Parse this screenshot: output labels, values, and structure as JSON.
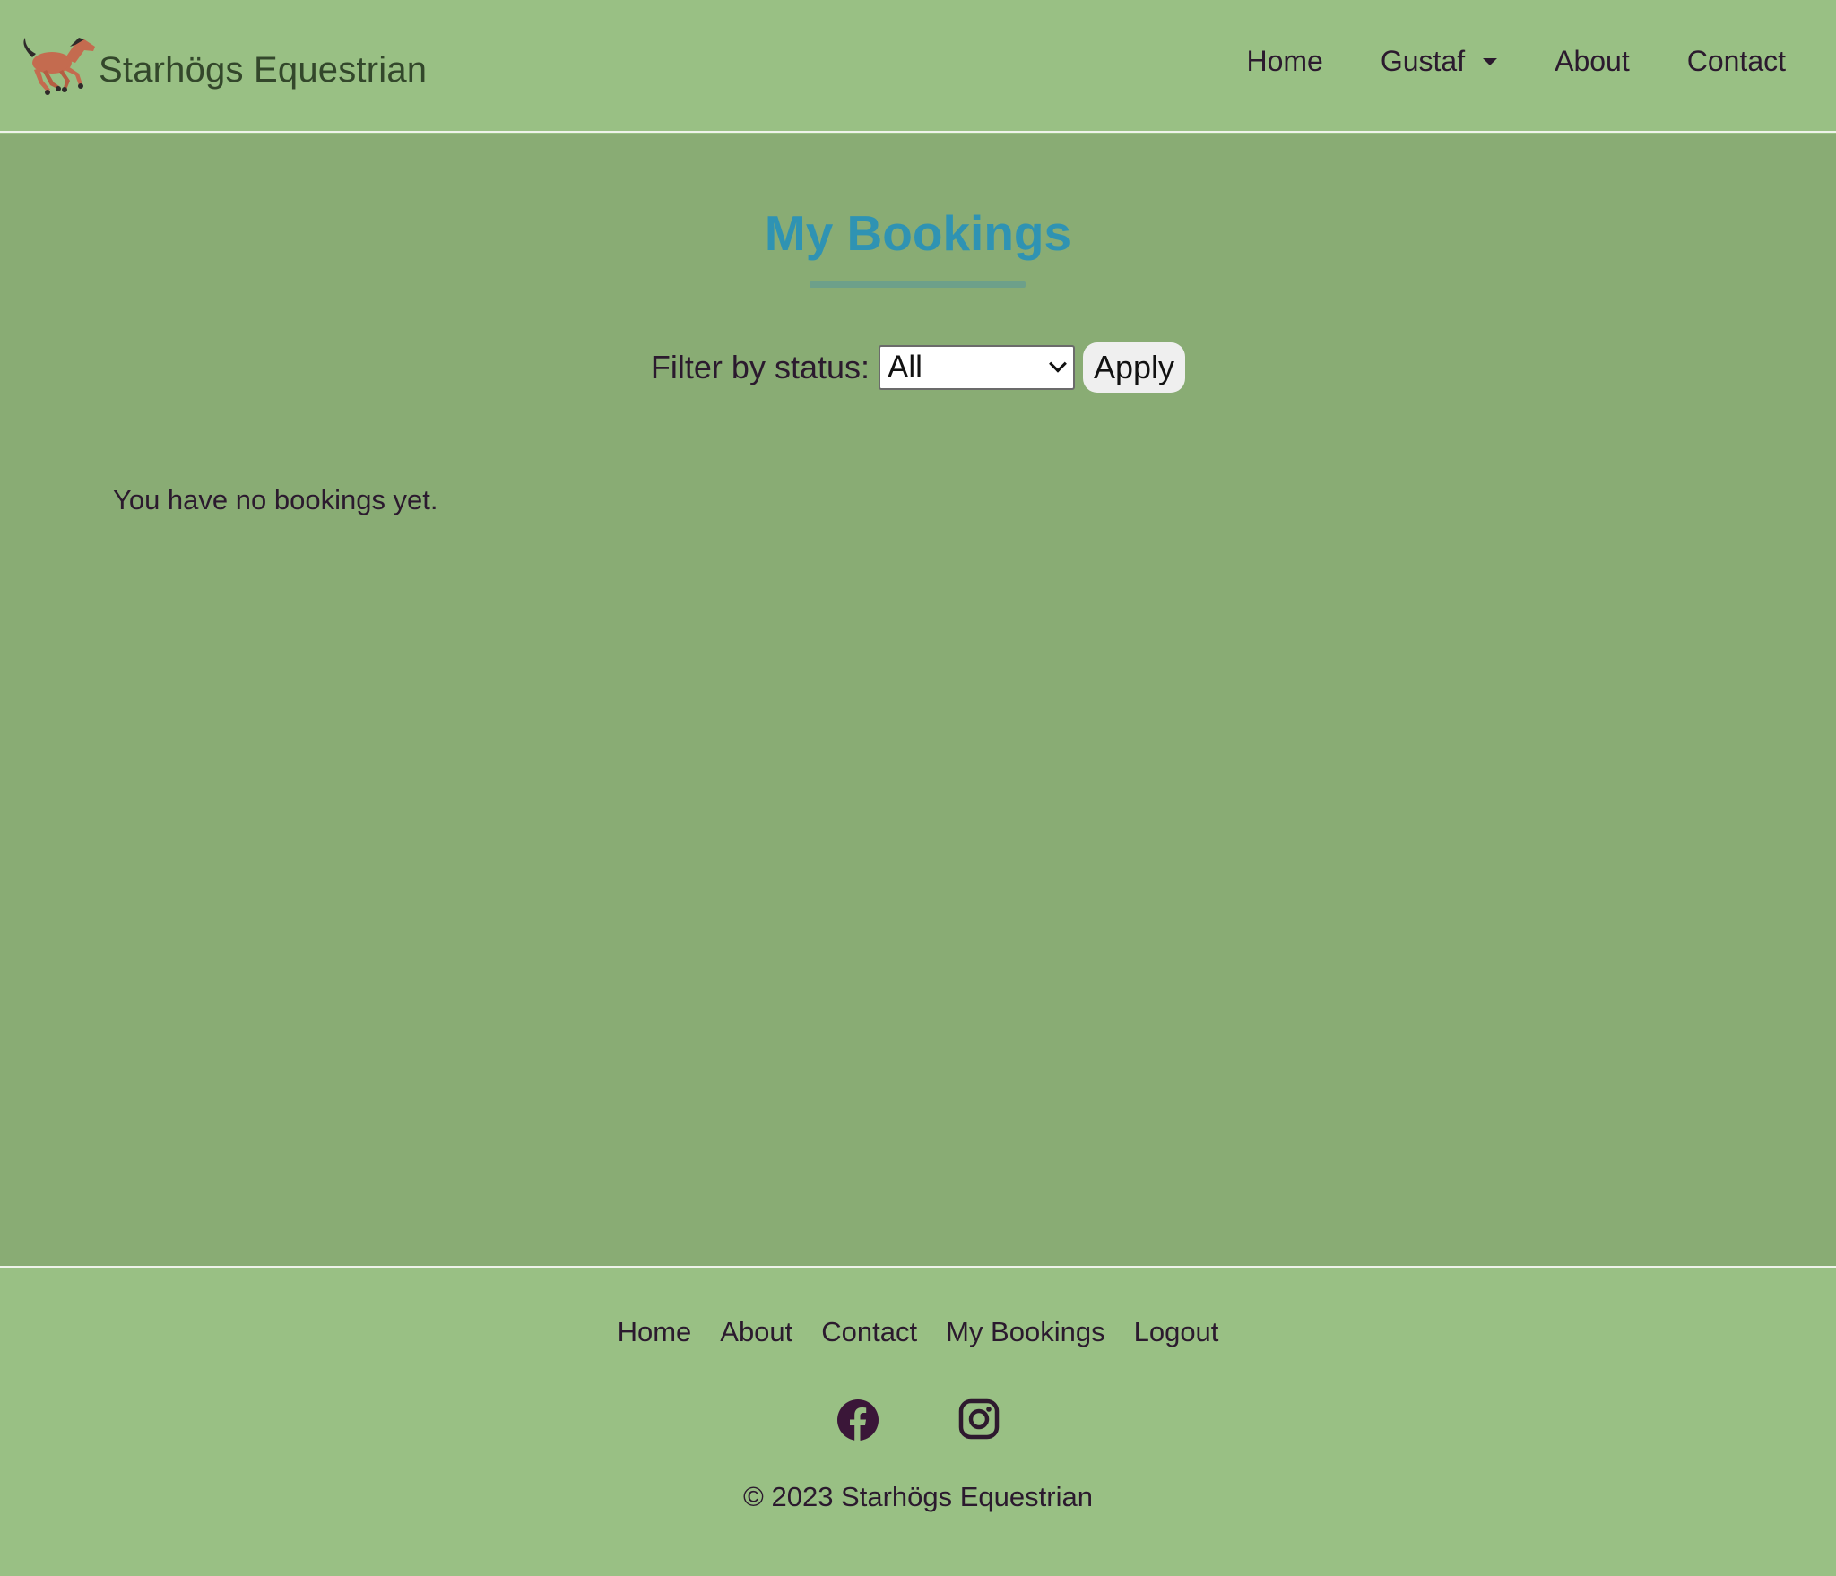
{
  "brand": {
    "name": "Starhögs Equestrian",
    "logo_icon": "galloping-horse-icon"
  },
  "nav": {
    "home": "Home",
    "user_menu": "Gustaf",
    "about": "About",
    "contact": "Contact"
  },
  "main": {
    "title": "My Bookings",
    "filter_label": "Filter by status:",
    "status_selected": "All",
    "apply_label": "Apply",
    "empty_message": "You have no bookings yet."
  },
  "footer": {
    "links": [
      "Home",
      "About",
      "Contact",
      "My Bookings",
      "Logout"
    ],
    "social_icons": [
      "facebook-icon",
      "instagram-icon"
    ],
    "copyright": "© 2023 Starhögs Equestrian"
  },
  "colors": {
    "header_bg": "#99c084",
    "main_bg": "#89ac74",
    "title": "#2f93b3",
    "text": "#2b1a2e"
  }
}
